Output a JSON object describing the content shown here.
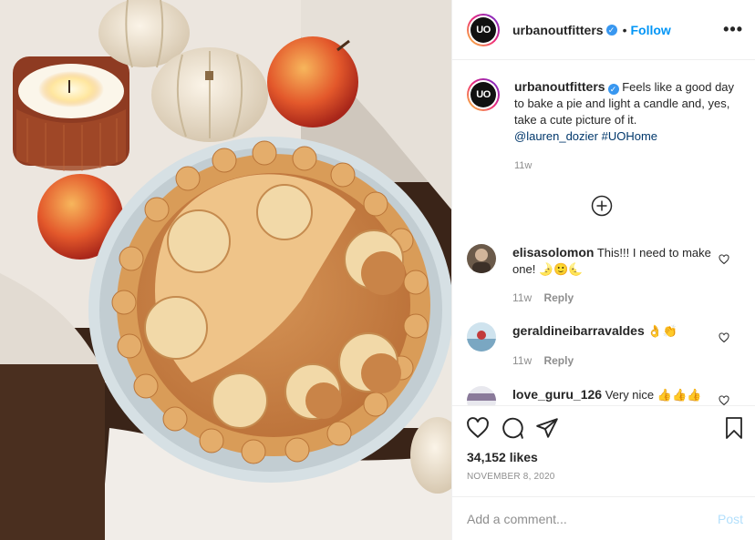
{
  "header": {
    "avatar_text": "UO",
    "username": "urbanoutfitters",
    "separator": "•",
    "follow_label": "Follow",
    "more_icon": "more-options-icon",
    "more_label": "•••"
  },
  "caption": {
    "username": "urbanoutfitters",
    "text": "Feels like a good day to bake a pie and light a candle and, yes, take a cute picture of it.",
    "mention": "@lauren_dozier",
    "hashtag": "#UOHome",
    "time": "11w"
  },
  "comments": [
    {
      "username": "elisasolomon",
      "text": "This!!! I need to make one! 🌛🙂🌜",
      "time": "11w",
      "reply_label": "Reply"
    },
    {
      "username": "geraldineibarravaldes",
      "text": "👌👏",
      "time": "11w",
      "reply_label": "Reply"
    },
    {
      "username": "love_guru_126",
      "text": "Very nice 👍👍👍"
    }
  ],
  "stats": {
    "likes": "34,152 likes",
    "date": "NOVEMBER 8, 2020"
  },
  "add_comment": {
    "placeholder": "Add a comment...",
    "post_label": "Post"
  },
  "colors": {
    "accent": "#0095f6",
    "verified": "#3897f0",
    "muted": "#8e8e8e",
    "post_disabled": "#b2dffc"
  }
}
